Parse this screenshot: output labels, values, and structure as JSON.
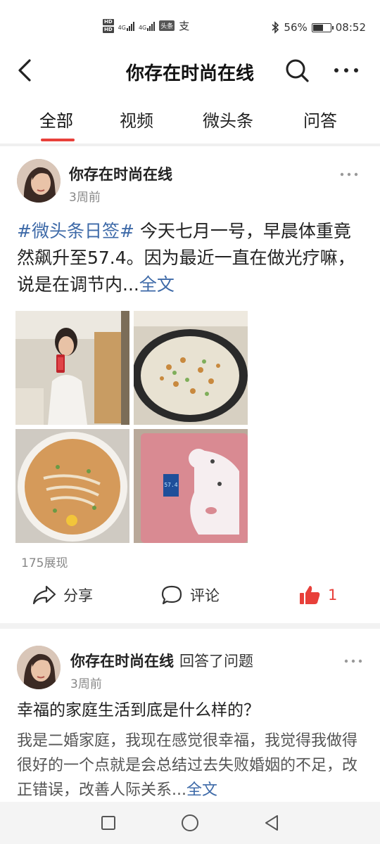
{
  "status_bar": {
    "hd_badges": [
      "HD",
      "HD"
    ],
    "network_1": "4G",
    "network_2": "4G",
    "app_badge": "头条",
    "alipay_icon": "支",
    "bluetooth_icon": "bluetooth-icon",
    "battery_percent": "56%",
    "battery_level": 0.56,
    "time": "08:52"
  },
  "header": {
    "title": "你存在时尚在线",
    "back_icon": "chevron-left-icon",
    "search_icon": "search-icon",
    "more_icon": "more-horizontal-icon"
  },
  "tabs": [
    {
      "label": "全部",
      "active": true
    },
    {
      "label": "视频",
      "active": false
    },
    {
      "label": "微头条",
      "active": false
    },
    {
      "label": "问答",
      "active": false
    }
  ],
  "accent_color": "#e8403a",
  "link_color": "#3e6aa8",
  "post1": {
    "author": "你存在时尚在线",
    "time": "3周前",
    "hashtag": "#微头条日签#",
    "text": " 今天七月一号，早晨体重竟然飙升至57.4。因为最近一直在做光疗嘛，说是在调节内...",
    "full_text_link": "全文",
    "images": [
      "mirror-selfie-photo",
      "pan-cooking-photo",
      "noodle-soup-photo",
      "scale-reading-photo"
    ],
    "scale_reading": "57.4",
    "views": "175展现",
    "share_label": "分享",
    "comment_label": "评论",
    "like_count": "1"
  },
  "post2": {
    "author": "你存在时尚在线",
    "action": "回答了问题",
    "time": "3周前",
    "question": "幸福的家庭生活到底是什么样的？",
    "answer": "我是二婚家庭，我现在感觉很幸福，我觉得我做得很好的一个点就是会总结过去失败婚姻的不足，改正错误，改善人际关系...",
    "full_text_link": "全文"
  },
  "nav_bar": {
    "recent_icon": "square-icon",
    "home_icon": "circle-icon",
    "back_icon": "triangle-back-icon"
  }
}
